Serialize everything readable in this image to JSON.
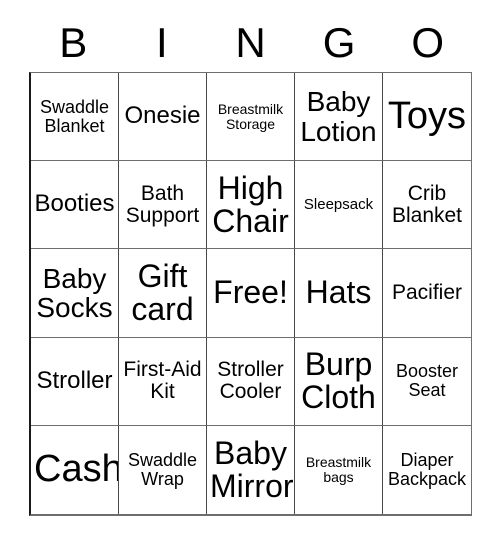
{
  "card": {
    "type": "bingo-card",
    "theme": "baby-shower",
    "headers": [
      "B",
      "I",
      "N",
      "G",
      "O"
    ],
    "grid_size": "5x5",
    "free_space": {
      "label": "Free!",
      "row": 3,
      "column": 3
    },
    "colors": {
      "background": "#ffffff",
      "text": "#000000",
      "border": "#4a4a4a",
      "border_outer": "#6e6e6e"
    },
    "rows": [
      [
        {
          "label": "Swaddle Blanket",
          "size": "xs"
        },
        {
          "label": "Onesie",
          "size": "md"
        },
        {
          "label": "Breastmilk Storage",
          "size": "tiny"
        },
        {
          "label": "Baby Lotion",
          "size": "lg"
        },
        {
          "label": "Toys",
          "size": "xxl"
        }
      ],
      [
        {
          "label": "Booties",
          "size": "md"
        },
        {
          "label": "Bath Support",
          "size": "sm"
        },
        {
          "label": "High Chair",
          "size": "xl"
        },
        {
          "label": "Sleepsack",
          "size": "xxs"
        },
        {
          "label": "Crib Blanket",
          "size": "sm"
        }
      ],
      [
        {
          "label": "Baby Socks",
          "size": "lg"
        },
        {
          "label": "Gift card",
          "size": "xl"
        },
        {
          "label": "Free!",
          "size": "xl"
        },
        {
          "label": "Hats",
          "size": "xl"
        },
        {
          "label": "Pacifier",
          "size": "sm"
        }
      ],
      [
        {
          "label": "Stroller",
          "size": "md"
        },
        {
          "label": "First-Aid Kit",
          "size": "sm"
        },
        {
          "label": "Stroller Cooler",
          "size": "sm"
        },
        {
          "label": "Burp Cloth",
          "size": "xl"
        },
        {
          "label": "Booster Seat",
          "size": "xs"
        }
      ],
      [
        {
          "label": "Cash",
          "size": "xxl"
        },
        {
          "label": "Swaddle Wrap",
          "size": "xs"
        },
        {
          "label": "Baby Mirror",
          "size": "xl"
        },
        {
          "label": "Breastmilk bags",
          "size": "tiny"
        },
        {
          "label": "Diaper Backpack",
          "size": "xs"
        }
      ]
    ]
  }
}
